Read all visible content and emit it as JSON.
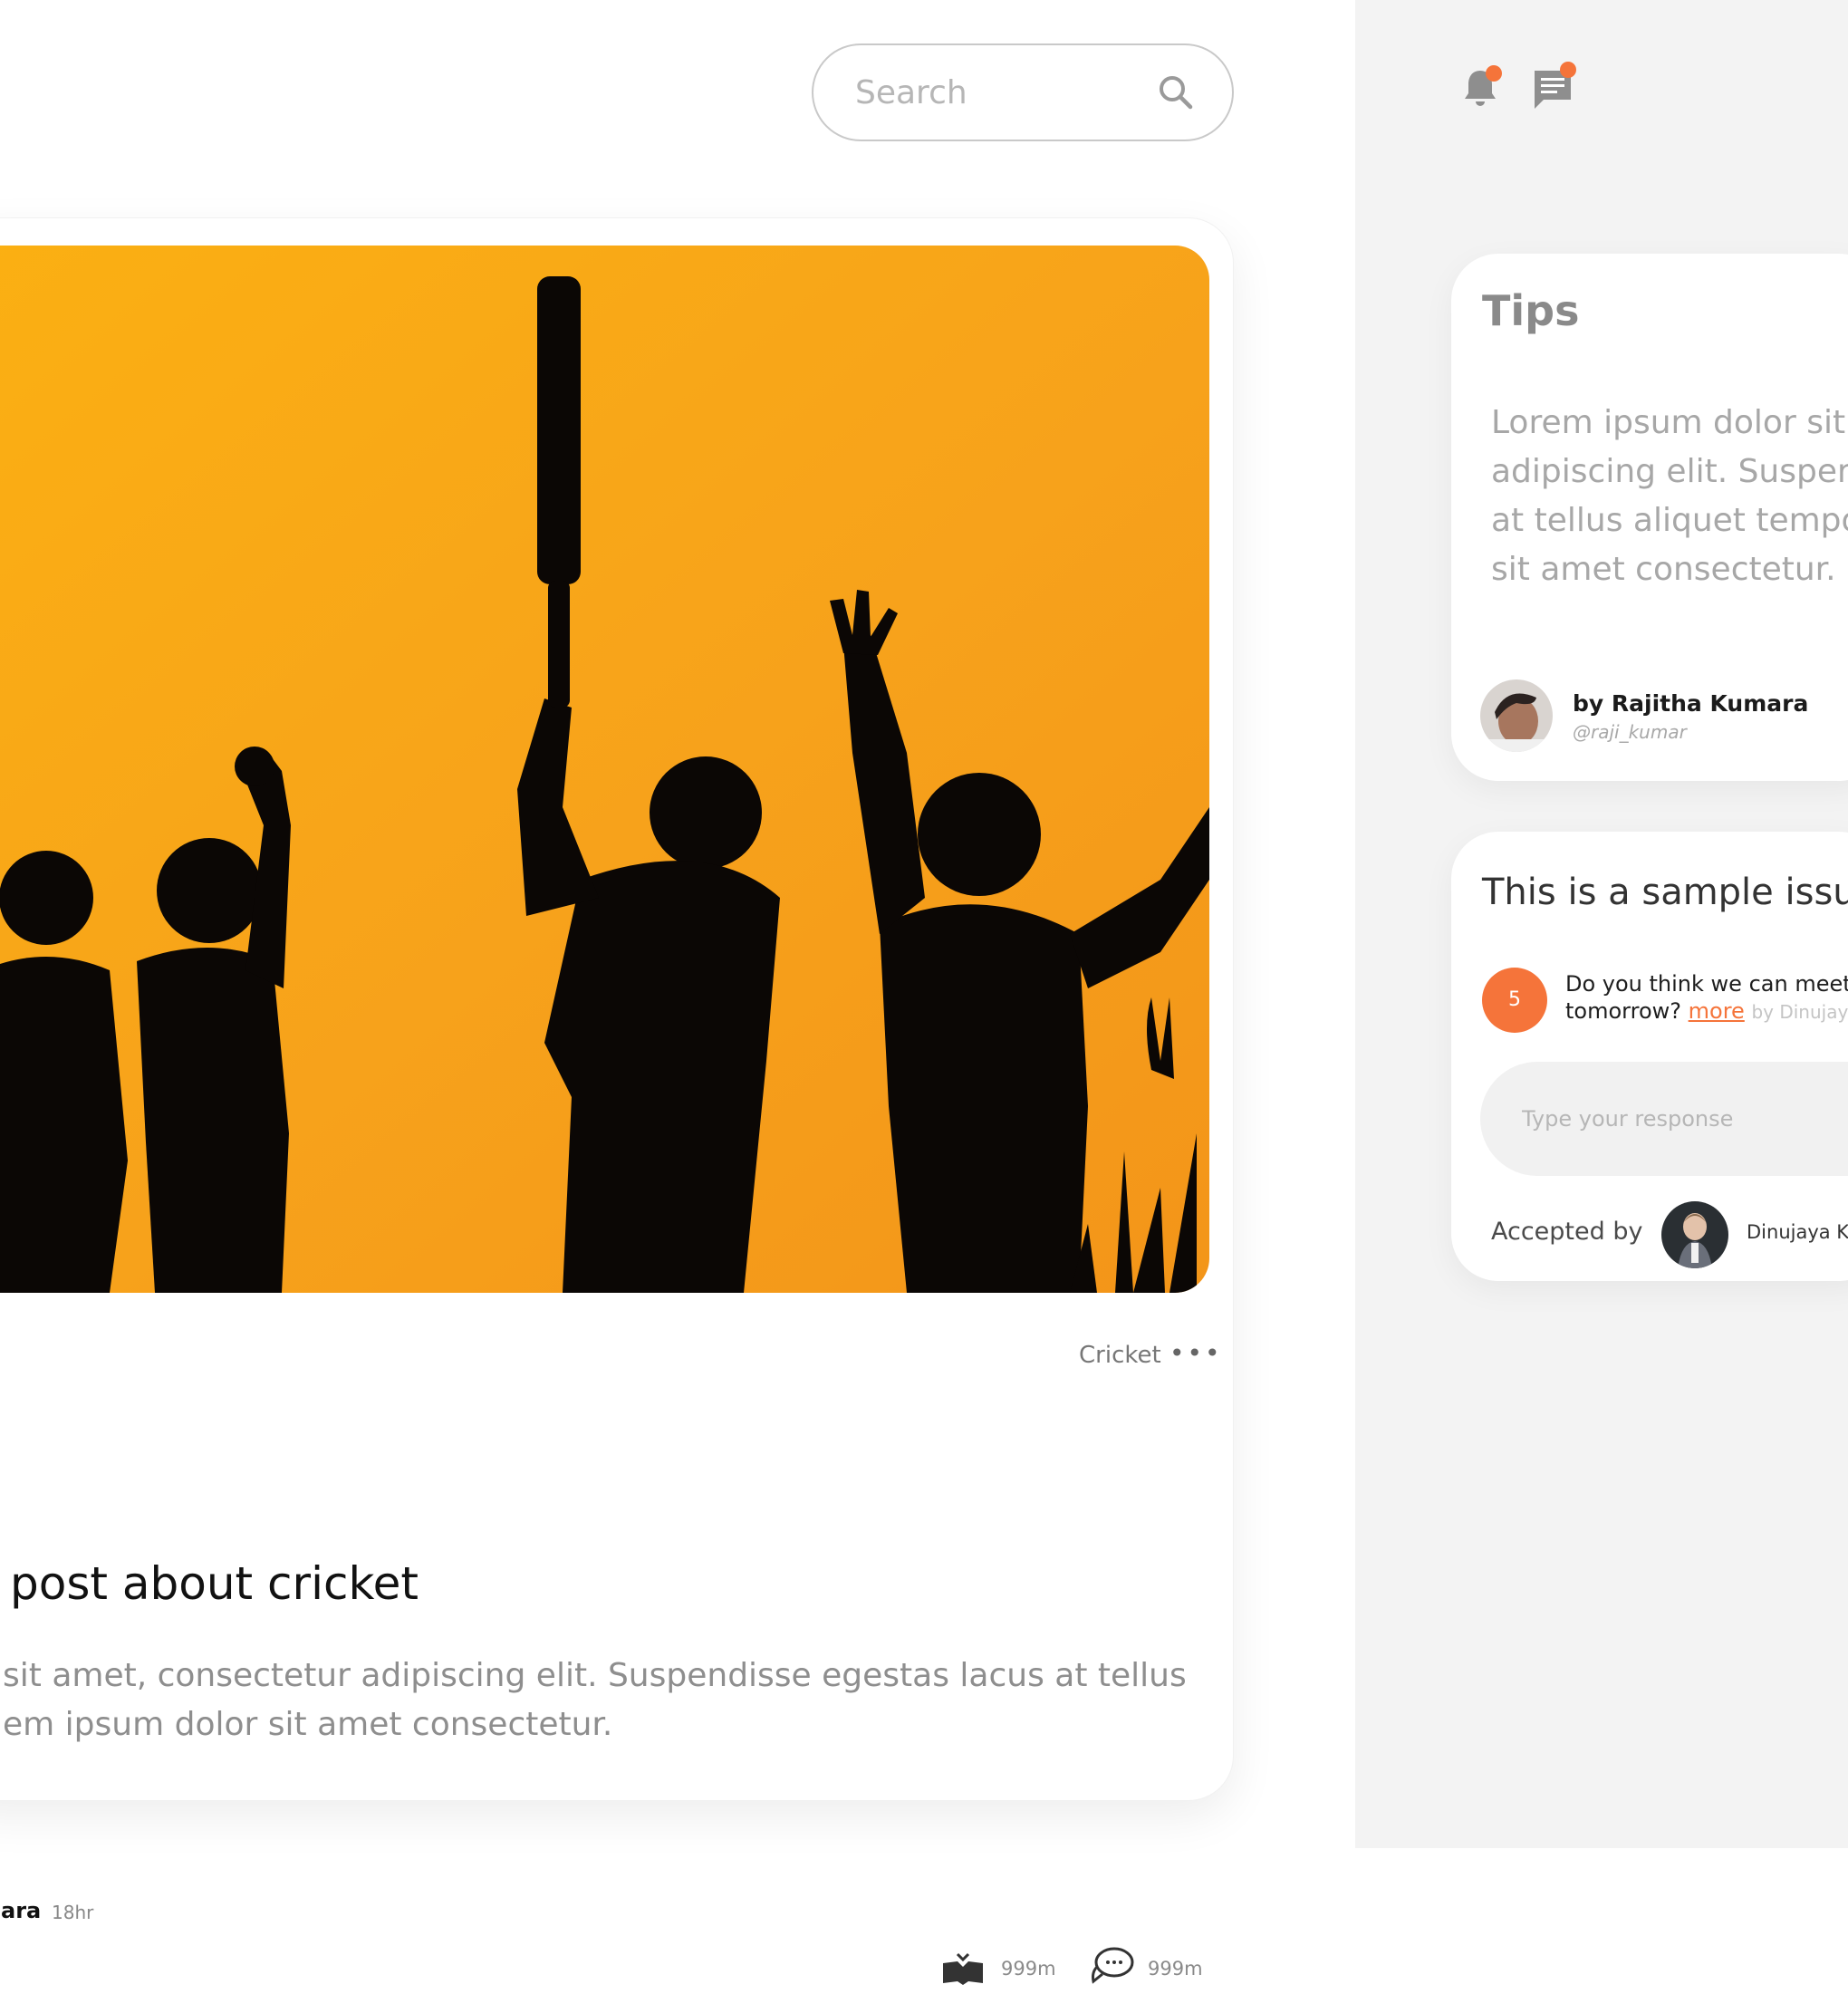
{
  "search": {
    "placeholder": "Search"
  },
  "header_icons": {
    "notifications": "bell-icon",
    "messages": "message-icon"
  },
  "post": {
    "title": "post about cricket",
    "tag": "Cricket",
    "text_lines": [
      "sit amet, consectetur adipiscing elit. Suspendisse egestas lacus at tellus",
      "em ipsum dolor sit amet consectetur."
    ],
    "author": "ara",
    "time": "18hr",
    "likes": "999m",
    "comments": "999m"
  },
  "tips": {
    "title": "Tips",
    "lines": [
      "Lorem ipsum dolor sit",
      "adipiscing elit. Susper",
      "at tellus aliquet tempo",
      "sit amet consectetur."
    ],
    "author_name": "by Rajitha Kumara",
    "author_handle": "@raji_kumar"
  },
  "issue": {
    "title": "This is a sample issu",
    "count": "5",
    "question_line1": "Do you think we can meet",
    "question_line2": "tomorrow?",
    "more_label": "more",
    "by_text": "by Dinujay",
    "response_placeholder": "Type your response",
    "accepted_label": "Accepted by",
    "accepted_name": "Dinujaya K"
  },
  "colors": {
    "accent": "#f5743a",
    "sky": "#f7a21b",
    "panel": "#f3f3f3"
  }
}
